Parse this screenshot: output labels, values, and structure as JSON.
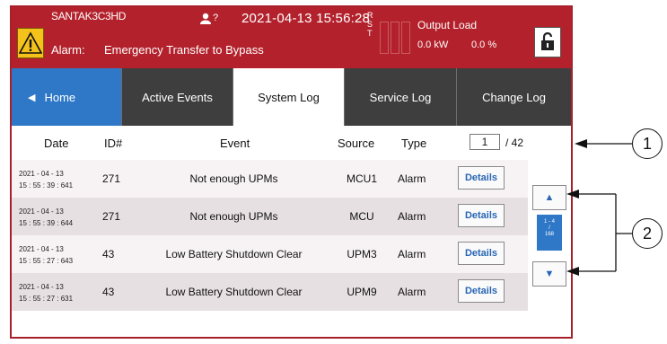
{
  "header": {
    "model": "SANTAK3C3HD",
    "alarm_label": "Alarm:",
    "alarm_text": "Emergency Transfer to Bypass",
    "person_q": "?",
    "datetime": "2021-04-13 15:56:28",
    "rst": [
      "R",
      "S",
      "T"
    ],
    "output_load_label": "Output Load",
    "output_kw": "0.0 kW",
    "output_pct": "0.0 %",
    "icons": [
      "warning-icon",
      "person-icon",
      "lock-icon"
    ],
    "colors": {
      "bar": "#b3222c",
      "warning": "#f5c21b"
    }
  },
  "tabs": [
    {
      "label": "Home",
      "icon": "left-triangle-icon"
    },
    {
      "label": "Active Events"
    },
    {
      "label": "System Log",
      "selected": true
    },
    {
      "label": "Service Log"
    },
    {
      "label": "Change Log"
    }
  ],
  "columns": {
    "date": "Date",
    "id": "ID#",
    "event": "Event",
    "source": "Source",
    "type": "Type"
  },
  "pager": {
    "current": "1",
    "total": "/ 42"
  },
  "rows": [
    {
      "date1": "2021 - 04 - 13",
      "date2": "15 : 55 : 39 : 641",
      "id": "271",
      "event": "Not enough UPMs",
      "source": "MCU1",
      "type": "Alarm",
      "action": "Details"
    },
    {
      "date1": "2021 - 04 - 13",
      "date2": "15 : 55 : 39 : 644",
      "id": "271",
      "event": "Not enough UPMs",
      "source": "MCU",
      "type": "Alarm",
      "action": "Details"
    },
    {
      "date1": "2021 - 04 - 13",
      "date2": "15 : 55 : 27 : 643",
      "id": "43",
      "event": "Low Battery Shutdown Clear",
      "source": "UPM3",
      "type": "Alarm",
      "action": "Details"
    },
    {
      "date1": "2021 - 04 - 13",
      "date2": "15 : 55 : 27 : 631",
      "id": "43",
      "event": "Low Battery Shutdown Clear",
      "source": "UPM9",
      "type": "Alarm",
      "action": "Details"
    }
  ],
  "scroll": {
    "up": "▲",
    "down": "▼",
    "range1": "1 - 4",
    "range2": "/",
    "range3": "168"
  },
  "callouts": [
    "1",
    "2"
  ],
  "accent": "#2e78c7"
}
